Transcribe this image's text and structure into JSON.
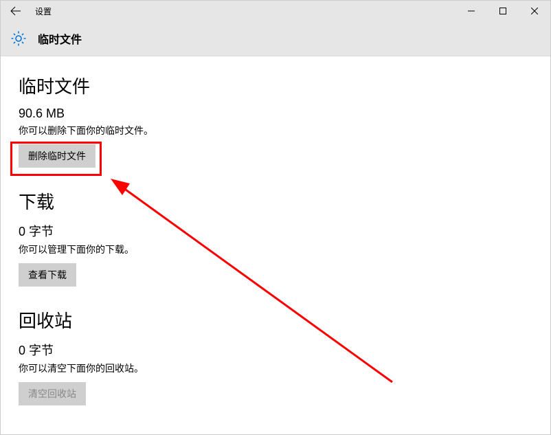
{
  "window": {
    "title": "设置"
  },
  "header": {
    "title": "临时文件"
  },
  "sections": {
    "temp": {
      "heading": "临时文件",
      "value": "90.6 MB",
      "desc": "你可以删除下面你的临时文件。",
      "button": "删除临时文件"
    },
    "downloads": {
      "heading": "下载",
      "value": "0 字节",
      "desc": "你可以管理下面你的下载。",
      "button": "查看下载"
    },
    "recycle": {
      "heading": "回收站",
      "value": "0 字节",
      "desc": "你可以清空下面你的回收站。",
      "button": "清空回收站"
    }
  }
}
